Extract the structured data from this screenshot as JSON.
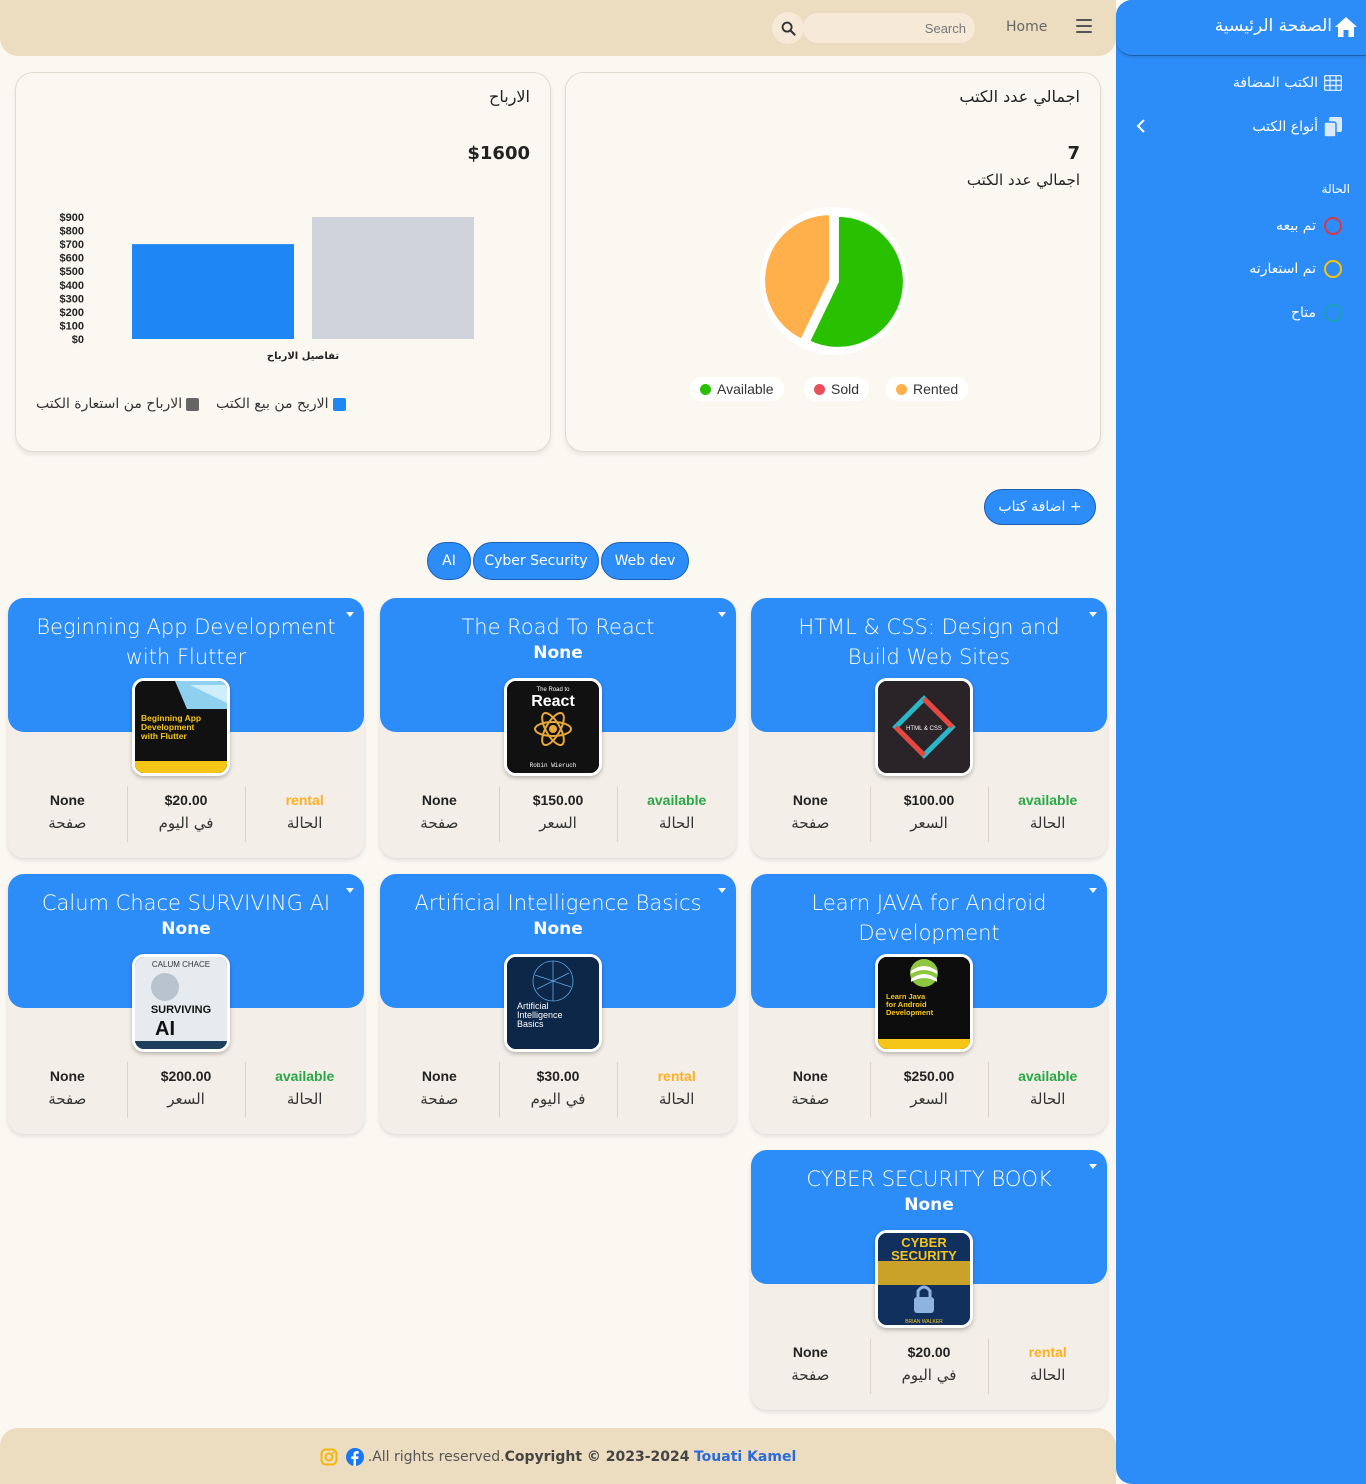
{
  "navbar": {
    "home": "Home",
    "search_placeholder": "Search"
  },
  "sidebar": {
    "title": "الصفحة الرئيسية",
    "items": [
      {
        "label": "الكتب المضافة",
        "icon": "table-icon"
      },
      {
        "label": "أنواع الكتب",
        "icon": "copy-icon"
      }
    ],
    "section": "الحالة",
    "statuses": [
      {
        "label": "تم بيعه",
        "color": "#dc3545"
      },
      {
        "label": "تم استعارته",
        "color": "#ffc107"
      },
      {
        "label": "متاح",
        "color": "#17a2b8"
      }
    ]
  },
  "total_books": {
    "title": "اجمالي عدد الكتب",
    "value": "7",
    "subtitle": "اجمالي عدد الكتب",
    "legend": [
      {
        "label": "Available",
        "color": "#28c000"
      },
      {
        "label": "Sold",
        "color": "#e8505b"
      },
      {
        "label": "Rented",
        "color": "#ffb04a"
      }
    ]
  },
  "profits": {
    "title": "الارباح",
    "value": "$1600",
    "legend": [
      {
        "label": "الاربح من بيع الكتب",
        "color": "#1f86f5"
      },
      {
        "label": "الارباح من استعارة الكتب",
        "color": "#666666"
      }
    ]
  },
  "chart_data": [
    {
      "type": "pie",
      "labels": [
        "Available",
        "Sold",
        "Rented"
      ],
      "values": [
        4,
        0,
        3
      ],
      "colors": [
        "#28c000",
        "#e8505b",
        "#ffb04a"
      ],
      "legend_position": "bottom"
    },
    {
      "type": "bar",
      "categories": [
        "تفاصيل الارباح"
      ],
      "series": [
        {
          "name": "الاربح من بيع الكتب",
          "values": [
            700
          ],
          "color": "#1f86f5"
        },
        {
          "name": "الارباح من استعارة الكتب",
          "values": [
            900
          ],
          "color": "#cfd4dc"
        }
      ],
      "y_ticks": [
        "$900",
        "$800",
        "$700",
        "$600",
        "$500",
        "$400",
        "$300",
        "$200",
        "$100",
        "$0"
      ],
      "ylim": [
        0,
        900
      ],
      "xlabel": "تفاصيل الارباح",
      "legend_position": "bottom"
    }
  ],
  "actions": {
    "add_book": "+ اضافة كتاب"
  },
  "filters": [
    "AI",
    "Cyber Security",
    "Web dev"
  ],
  "books": [
    {
      "title": "HTML & CSS: Design and Build Web Sites",
      "subtitle": "",
      "pages": "None",
      "pages_label": "صفحة",
      "price": "$100.00",
      "price_label": "السعر",
      "status": "available",
      "status_label": "الحالة",
      "status_color": "#28a745"
    },
    {
      "title": "The Road To React",
      "subtitle": "None",
      "pages": "None",
      "pages_label": "صفحة",
      "price": "$150.00",
      "price_label": "السعر",
      "status": "available",
      "status_label": "الحالة",
      "status_color": "#28a745"
    },
    {
      "title": "Beginning App Development with Flutter",
      "subtitle": "",
      "pages": "None",
      "pages_label": "صفحة",
      "price": "$20.00",
      "price_label": "في اليوم",
      "status": "rental",
      "status_label": "الحالة",
      "status_color": "#ffb020"
    },
    {
      "title": "Learn JAVA for Android Development",
      "subtitle": "",
      "pages": "None",
      "pages_label": "صفحة",
      "price": "$250.00",
      "price_label": "السعر",
      "status": "available",
      "status_label": "الحالة",
      "status_color": "#28a745"
    },
    {
      "title": "Artificial Intelligence Basics",
      "subtitle": "None",
      "pages": "None",
      "pages_label": "صفحة",
      "price": "$30.00",
      "price_label": "في اليوم",
      "status": "rental",
      "status_label": "الحالة",
      "status_color": "#ffb020"
    },
    {
      "title": "Calum Chace SURVIVING AI",
      "subtitle": "None",
      "pages": "None",
      "pages_label": "صفحة",
      "price": "$200.00",
      "price_label": "السعر",
      "status": "available",
      "status_label": "الحالة",
      "status_color": "#28a745"
    },
    {
      "title": "CYBER SECURITY BOOK",
      "subtitle": "None",
      "pages": "None",
      "pages_label": "صفحة",
      "price": "$20.00",
      "price_label": "في اليوم",
      "status": "rental",
      "status_label": "الحالة",
      "status_color": "#ffb020"
    }
  ],
  "covers": [
    {
      "title_text": "HTML & CSS",
      "bg": "#2a2328"
    },
    {
      "title_text": "The Road to",
      "main": "React",
      "author": "Robin Wieruch",
      "bg": "#111111"
    },
    {
      "title_text": "Beginning App Development with Flutter",
      "bg": "#111111"
    },
    {
      "title_text": "Learn Java for Android Development",
      "bg": "#0d0d0d"
    },
    {
      "title_text": "Artificial Intelligence Basics",
      "bg": "#0d2748"
    },
    {
      "top": "CALUM CHACE",
      "main": "SURVIVING",
      "big": "AI",
      "bg": "#e7ebef"
    },
    {
      "title_text": "CYBER SECURITY",
      "author": "BRIAN WALKER",
      "bg": "#12305e"
    }
  ],
  "footer": {
    "text": ".All rights reserved.",
    "copyright": "Copyright © 2023-2024",
    "name": "Touati Kamel"
  }
}
